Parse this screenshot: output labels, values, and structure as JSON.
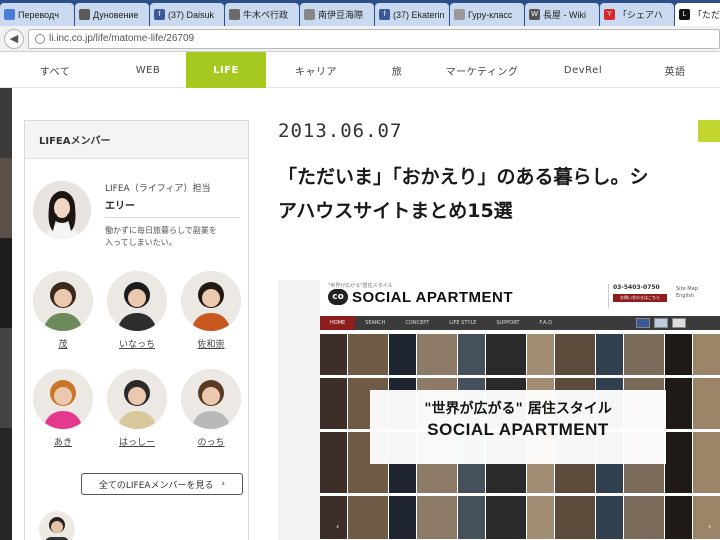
{
  "browser": {
    "tabs": [
      {
        "label": "Переводч",
        "fav_color": "#4a7bd6",
        "fav_glyph": ""
      },
      {
        "label": "Дуновение",
        "fav_color": "#5a5a5a",
        "fav_glyph": ""
      },
      {
        "label": "(37) Daisuk",
        "fav_color": "#3b5998",
        "fav_glyph": "f"
      },
      {
        "label": "牛木ペ行政",
        "fav_color": "#6a6a6a",
        "fav_glyph": ""
      },
      {
        "label": "南伊豆海際",
        "fav_color": "#888888",
        "fav_glyph": ""
      },
      {
        "label": "(37) Ekaterin",
        "fav_color": "#3b5998",
        "fav_glyph": "f"
      },
      {
        "label": "Гуру-класс",
        "fav_color": "#999999",
        "fav_glyph": ""
      },
      {
        "label": "長屋 - Wiki",
        "fav_color": "#555555",
        "fav_glyph": "W"
      },
      {
        "label": "「シェアハ",
        "fav_color": "#d8282b",
        "fav_glyph": "Y"
      },
      {
        "label": "「ただい",
        "fav_color": "#111111",
        "fav_glyph": "L"
      }
    ],
    "url": "li.inc.co.jp/life/matome-life/26709"
  },
  "nav": {
    "items": [
      "すべて",
      "WEB",
      "LIFE",
      "キャリア",
      "旅",
      "マーケティング",
      "DevRel",
      "英語"
    ],
    "active": "LIFE"
  },
  "sidebar": {
    "title": "LIFEAメンバー",
    "featured": {
      "role": "LIFEA（ライフィア）担当",
      "name": "エリー",
      "desc": "働かずに毎日旅暮らしで副業を\n入ってしまいたい。"
    },
    "members": [
      {
        "name": "茂"
      },
      {
        "name": "いなっち"
      },
      {
        "name": "佐和崇"
      },
      {
        "name": "あき"
      },
      {
        "name": "はっしー"
      },
      {
        "name": "のっち"
      }
    ],
    "all_button": "全てのLIFEAメンバーを見る",
    "all_chevron": "›"
  },
  "article": {
    "date": "2013.06.07",
    "title_line1": "「ただいま」「おかえり」のある暮らし。シ",
    "title_line2": "アハウスサイトまとめ15選"
  },
  "screenshot": {
    "tagline": "\"世界が広がる\"居住スタイル",
    "logo_mark": "co",
    "logo_text": "SOCIAL APARTMENT",
    "phone": "03-5403-0750",
    "contact_button": "お問い合わせはこちら",
    "sitemap_1": "Site Map",
    "sitemap_2": "English",
    "nav": [
      "HOME",
      "SEARCH",
      "CONCEPT",
      "LIFE STYLE",
      "SUPPORT",
      "F.A.Q"
    ],
    "hero_sub": "\"世界が広がる\" 居住スタイル",
    "hero_main": "SOCIAL APARTMENT",
    "arrow_left": "‹",
    "arrow_right": "›"
  },
  "colors": {
    "tabstrip": "#2b4f86",
    "nav_active": "#a6c91f",
    "date_bar": "#c3d630",
    "sa_accent": "#8e1d1d"
  }
}
